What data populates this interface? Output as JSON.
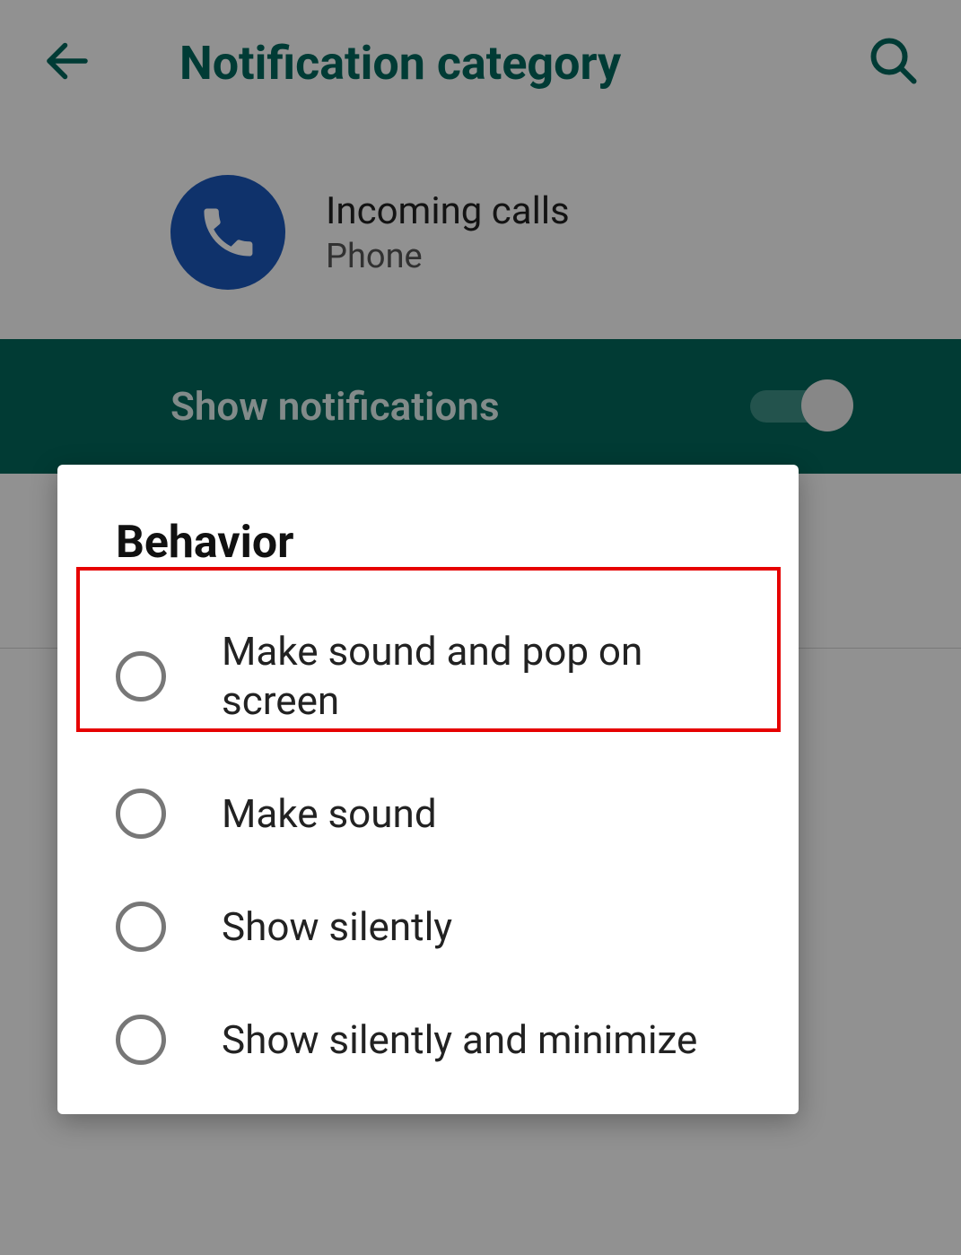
{
  "header": {
    "title": "Notification category"
  },
  "app": {
    "title": "Incoming calls",
    "subtitle": "Phone"
  },
  "toggle": {
    "label": "Show notifications",
    "on": true
  },
  "dialog": {
    "title": "Behavior",
    "options": [
      {
        "label": "Make sound and pop on screen"
      },
      {
        "label": "Make sound"
      },
      {
        "label": "Show silently"
      },
      {
        "label": "Show silently and minimize"
      }
    ],
    "highlighted_index": 0
  }
}
